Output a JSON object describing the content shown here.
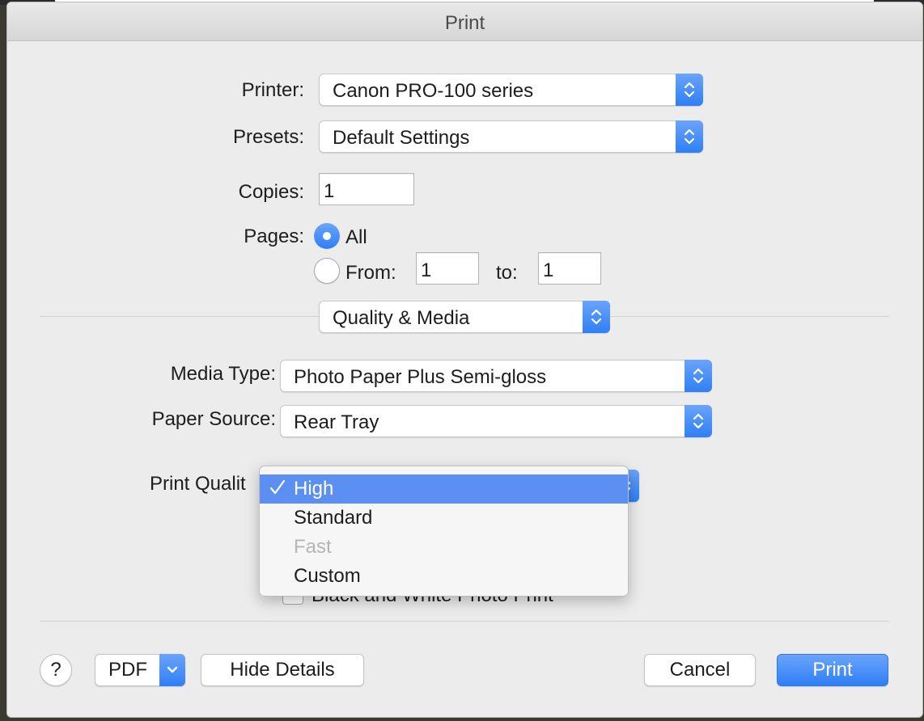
{
  "window": {
    "title": "Print"
  },
  "printer": {
    "label": "Printer:",
    "value": "Canon PRO-100 series"
  },
  "presets": {
    "label": "Presets:",
    "value": "Default Settings"
  },
  "copies": {
    "label": "Copies:",
    "value": "1"
  },
  "pages": {
    "label": "Pages:",
    "all_label": "All",
    "from_label": "From:",
    "from_value": "1",
    "to_label": "to:",
    "to_value": "1",
    "selected": "All"
  },
  "panel_selector": {
    "value": "Quality & Media"
  },
  "media_type": {
    "label": "Media Type:",
    "value": "Photo Paper Plus Semi-gloss"
  },
  "paper_source": {
    "label": "Paper Source:",
    "value": "Rear Tray"
  },
  "print_quality": {
    "label": "Print Qualit",
    "menu": [
      {
        "label": "High",
        "selected": true,
        "enabled": true
      },
      {
        "label": "Standard",
        "selected": false,
        "enabled": true
      },
      {
        "label": "Fast",
        "selected": false,
        "enabled": false
      },
      {
        "label": "Custom",
        "selected": false,
        "enabled": true
      }
    ]
  },
  "bw_photo_print": {
    "label": "Black and White Photo Print",
    "checked": false
  },
  "footer": {
    "help_label": "?",
    "pdf_label": "PDF",
    "hide_details_label": "Hide Details",
    "cancel_label": "Cancel",
    "print_label": "Print"
  },
  "colors": {
    "accent": "#2f7ff5",
    "menu_selection": "#5b8ff2"
  },
  "icons": {
    "popup": "up-down-chevron-icon",
    "pdf": "chevron-down-icon",
    "check": "checkmark-icon"
  }
}
